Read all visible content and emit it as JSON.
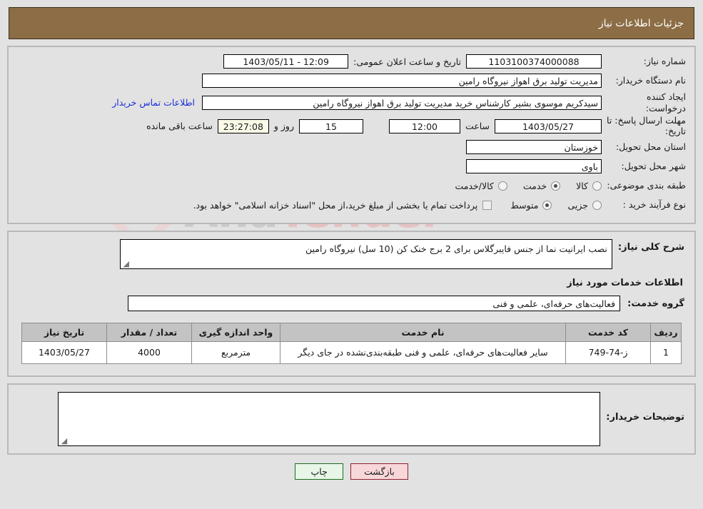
{
  "header": {
    "title": "جزئیات اطلاعات نیاز"
  },
  "top": {
    "need_number_label": "شماره نیاز:",
    "need_number_value": "1103100374000088",
    "announce_label": "تاریخ و ساعت اعلان عمومی:",
    "announce_value": "12:09 - 1403/05/11",
    "buyer_org_label": "نام دستگاه خریدار:",
    "buyer_org_value": "مدیریت تولید برق اهواز نیروگاه رامین",
    "creator_label": "ایجاد کننده درخواست:",
    "creator_value": "سیدکریم موسوی بشیر کارشناس خرید مدیریت تولید برق اهواز نیروگاه رامین",
    "contact_link": "اطلاعات تماس خریدار",
    "deadline_label": "مهلت ارسال پاسخ: تا تاریخ:",
    "deadline_date": "1403/05/27",
    "hour_label": "ساعت",
    "deadline_time": "12:00",
    "days_remaining": "15",
    "days_label": "روز و",
    "countdown": "23:27:08",
    "remaining_label": "ساعت باقی مانده",
    "province_label": "استان محل تحویل:",
    "province_value": "خوزستان",
    "city_label": "شهر محل تحویل:",
    "city_value": "باوی",
    "category_label": "طبقه بندی موضوعی:",
    "category_options": [
      {
        "label": "کالا",
        "checked": false
      },
      {
        "label": "خدمت",
        "checked": true
      },
      {
        "label": "کالا/خدمت",
        "checked": false
      }
    ],
    "process_label": "نوع فرآیند خرید :",
    "process_options": [
      {
        "label": "جزیی",
        "checked": false
      },
      {
        "label": "متوسط",
        "checked": true
      }
    ],
    "treasury_checkbox_checked": false,
    "treasury_note": "پرداخت تمام یا بخشی از مبلغ خرید،از محل \"اسناد خزانه اسلامی\" خواهد بود."
  },
  "mid": {
    "description_label": "شرح کلی نیاز:",
    "description_value": "نصب ایرانیت نما از جنس فایبرگلاس برای 2 برج خنک کن (10 سل) نیروگاه رامین",
    "services_section_title": "اطلاعات خدمات مورد نیاز",
    "service_group_label": "گروه خدمت:",
    "service_group_value": "فعالیت‌های حرفه‌ای، علمی و فنی",
    "table": {
      "columns": [
        "ردیف",
        "کد خدمت",
        "نام خدمت",
        "واحد اندازه گیری",
        "تعداد / مقدار",
        "تاریخ نیاز"
      ],
      "rows": [
        {
          "radif": "1",
          "code": "ز-74-749",
          "name": "سایر فعالیت‌های حرفه‌ای، علمی و فنی طبقه‌بندی‌نشده در جای دیگر",
          "unit": "مترمربع",
          "qty": "4000",
          "date": "1403/05/27"
        }
      ]
    }
  },
  "notes": {
    "buyer_notes_label": "توضیحات خریدار:",
    "buyer_notes_value": ""
  },
  "buttons": {
    "back": "بازگشت",
    "print": "چاپ"
  },
  "watermark": {
    "text_left": "Ana",
    "text_right": "Tender",
    "suffix": ".ir"
  }
}
